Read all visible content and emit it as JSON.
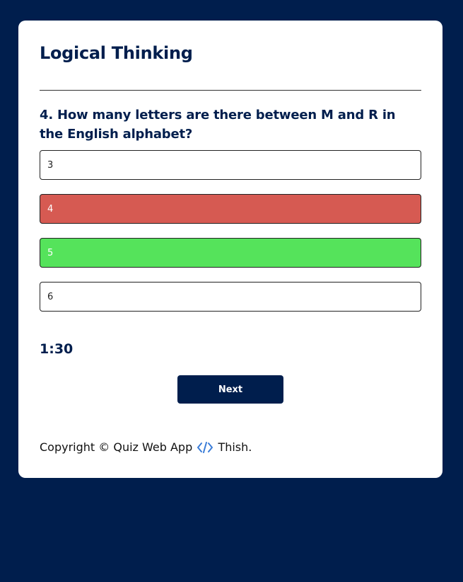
{
  "quiz": {
    "title": "Logical Thinking",
    "question": "4. How many letters are there between M and R in the English alphabet?",
    "answers": [
      {
        "label": "3",
        "state": "default"
      },
      {
        "label": "4",
        "state": "incorrect"
      },
      {
        "label": "5",
        "state": "correct"
      },
      {
        "label": "6",
        "state": "default"
      }
    ],
    "timer": "1:30",
    "next_label": "Next"
  },
  "footer": {
    "copyright_prefix": "Copyright © Quiz Web App",
    "author": "Thish."
  },
  "colors": {
    "background": "#001e4d",
    "card": "#ffffff",
    "incorrect": "#d65a52",
    "correct": "#55e35b",
    "icon_accent": "#3b7dd8"
  }
}
